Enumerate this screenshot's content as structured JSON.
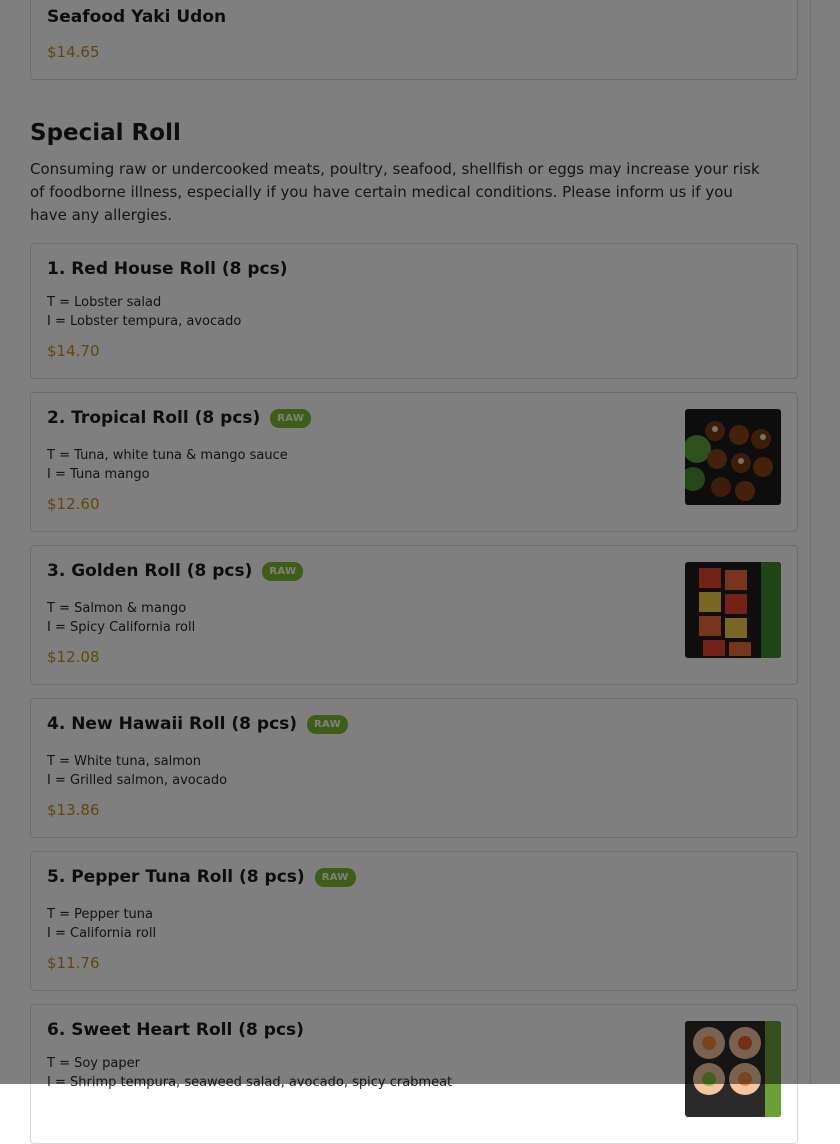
{
  "prev_item": {
    "name": "Seafood Yaki Udon",
    "price": "$14.65"
  },
  "section": {
    "title": "Special Roll",
    "description": "Consuming raw or undercooked meats, poultry, seafood, shellfish or eggs may increase your risk of foodborne illness, especially if you have certain medical conditions. Please inform us if you have any allergies."
  },
  "raw_badge": "RAW",
  "items": [
    {
      "name": "1. Red House Roll (8 pcs)",
      "line1": "T = Lobster salad",
      "line2": "I = Lobster tempura, avocado",
      "price": "$14.70"
    },
    {
      "name": "2. Tropical Roll (8 pcs)",
      "line1": "T = Tuna, white tuna & mango sauce",
      "line2": "I = Tuna mango",
      "price": "$12.60"
    },
    {
      "name": "3. Golden Roll (8 pcs)",
      "line1": "T = Salmon & mango",
      "line2": "I = Spicy California roll",
      "price": "$12.08"
    },
    {
      "name": "4. New Hawaii Roll (8 pcs)",
      "line1": "T = White tuna, salmon",
      "line2": "I = Grilled salmon, avocado",
      "price": "$13.86"
    },
    {
      "name": "5. Pepper Tuna Roll (8 pcs)",
      "line1": "T = Pepper tuna",
      "line2": "I = California roll",
      "price": "$11.76"
    },
    {
      "name": "6. Sweet Heart Roll (8 pcs)",
      "line1": "T = Soy paper",
      "line2": "I = Shrimp tempura, seaweed salad, avocado, spicy crabmeat",
      "price": ""
    }
  ],
  "colors": {
    "price": "#c58e11",
    "raw_badge": "#7cbc2f",
    "overlay": "rgba(0,0,0,0.5)"
  }
}
